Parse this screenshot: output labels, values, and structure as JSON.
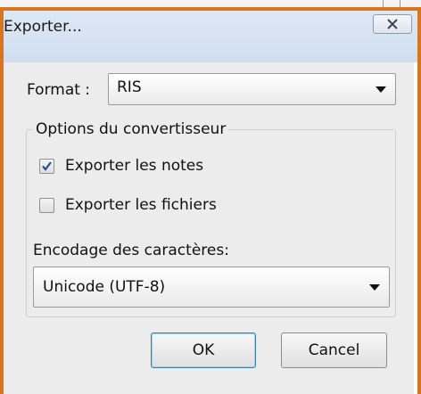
{
  "dialog": {
    "title": "Exporter...",
    "format_label": "Format :",
    "format_value": "RIS",
    "options_group_label": "Options du convertisseur",
    "options": [
      {
        "label": "Exporter les notes",
        "checked": true
      },
      {
        "label": "Exporter les fichiers",
        "checked": false
      }
    ],
    "encoding_label": "Encodage des caractères:",
    "encoding_value": "Unicode (UTF-8)",
    "ok_label": "OK",
    "cancel_label": "Cancel"
  },
  "colors": {
    "frame_border": "#d9751f",
    "titlebar": "#d6e3f2",
    "body_bg": "#ececec"
  },
  "icons": {
    "close": "close-icon",
    "checkmark": "checkmark-icon",
    "dropdown": "chevron-down-icon"
  }
}
